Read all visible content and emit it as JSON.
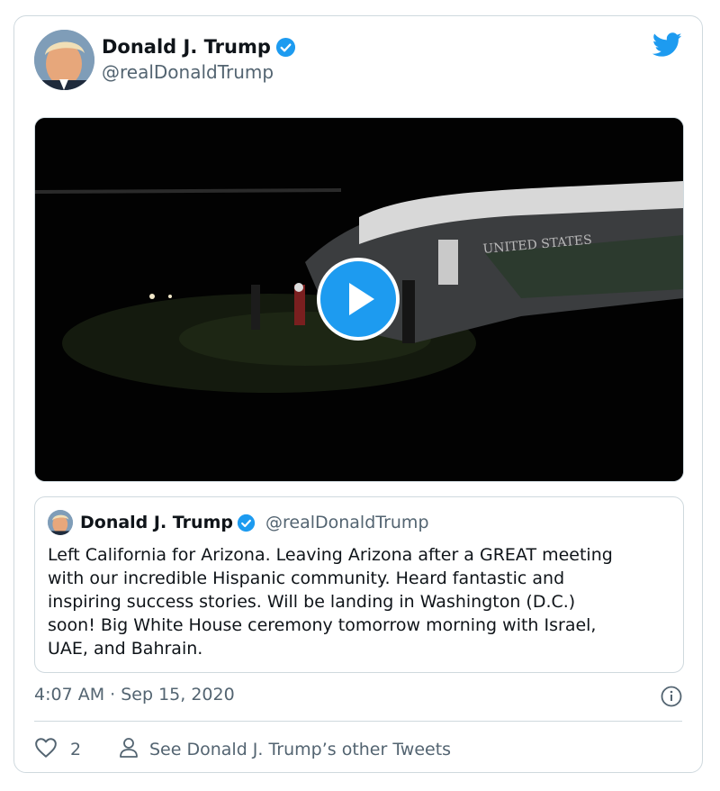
{
  "tweet": {
    "author": {
      "name": "Donald J. Trump",
      "handle": "@realDonaldTrump",
      "verified": true
    },
    "icons": {
      "logo": "twitter-bird-icon",
      "verified": "verified-badge-icon",
      "play": "play-icon",
      "info": "info-icon",
      "like": "heart-icon",
      "profile": "person-icon"
    },
    "colors": {
      "brand": "#1d9bf0",
      "text": "#0f1419",
      "secondary": "#536471",
      "border": "#cfd9de"
    },
    "media": {
      "type": "video",
      "caption_visible": "UNITED STATES"
    },
    "quoted": {
      "name": "Donald J. Trump",
      "handle": "@realDonaldTrump",
      "text_lines": [
        "Left California for Arizona. Leaving Arizona after a GREAT meeting",
        "with our incredible Hispanic community. Heard fantastic and",
        "inspiring success stories. Will be landing in Washington (D.C.)",
        "soon! Big White House ceremony tomorrow morning with Israel,",
        "UAE, and Bahrain."
      ]
    },
    "timestamp": "4:07 AM · Sep 15, 2020",
    "actions": {
      "like_count": "2",
      "other_tweets_label": "See Donald J. Trump’s other Tweets"
    }
  }
}
